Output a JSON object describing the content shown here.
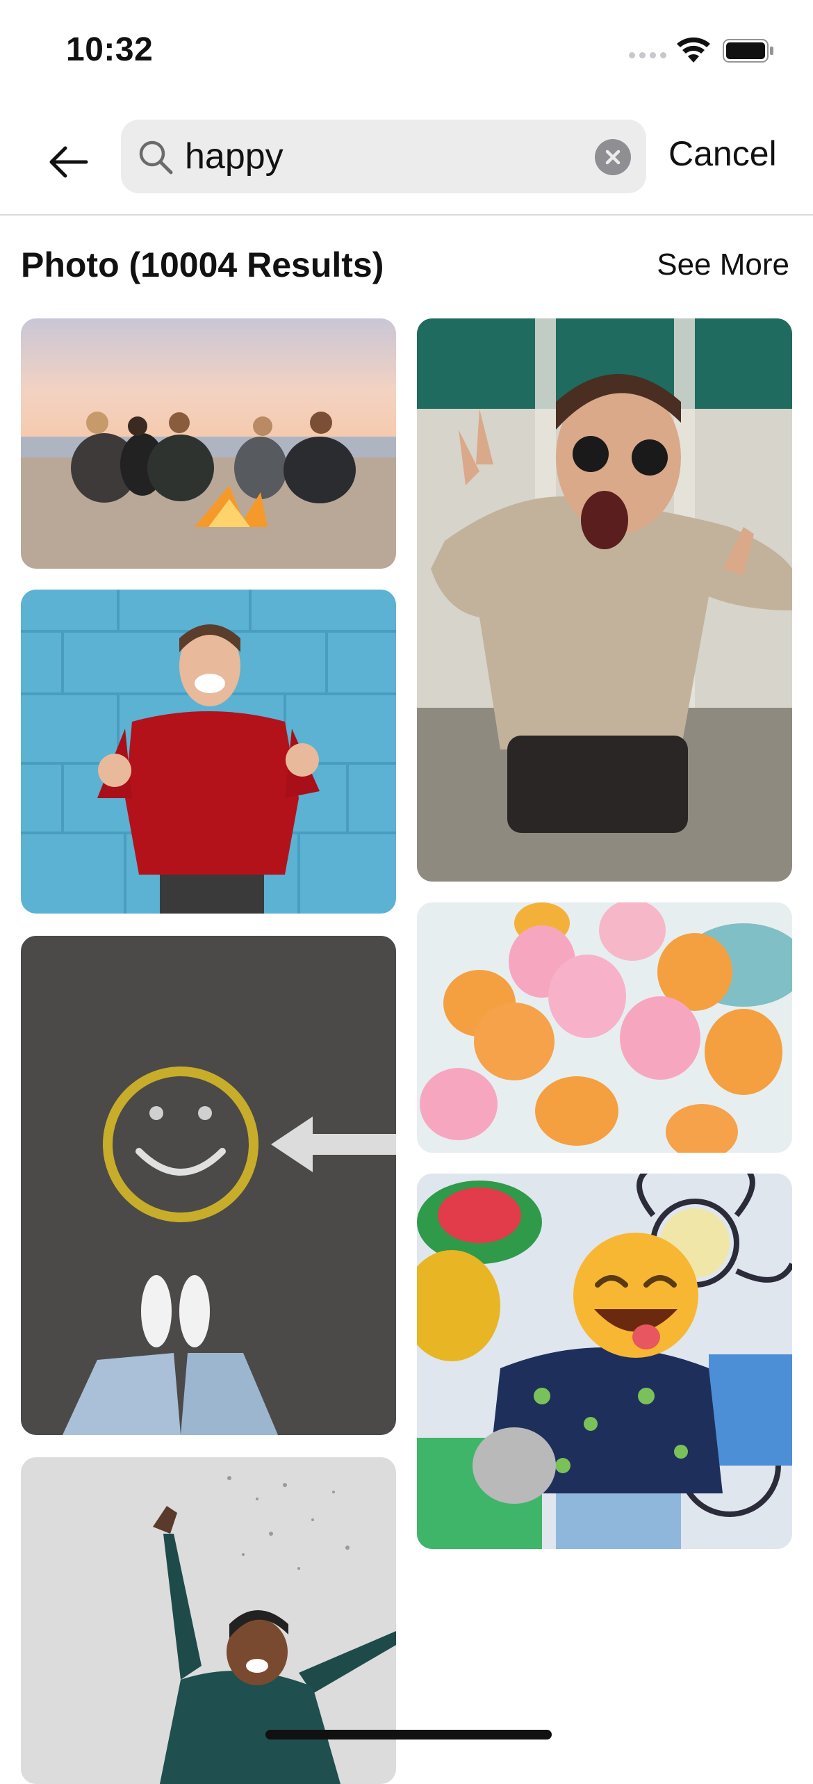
{
  "status_bar": {
    "time": "10:32"
  },
  "search": {
    "query": "happy",
    "cancel_label": "Cancel"
  },
  "section": {
    "title": "Photo (10004 Results)",
    "see_more_label": "See More"
  },
  "photos": [
    {
      "subject": "friends-campfire-beach"
    },
    {
      "subject": "woman-sunglasses-peace-sign"
    },
    {
      "subject": "man-red-sweater-blue-wall"
    },
    {
      "subject": "balloons-sky"
    },
    {
      "subject": "smiley-face-chalk-ground"
    },
    {
      "subject": "emoji-balloon-graffiti-wall"
    },
    {
      "subject": "woman-confetti-jump"
    }
  ],
  "colors": {
    "accent": "#111111",
    "search_bg": "#ececec"
  }
}
